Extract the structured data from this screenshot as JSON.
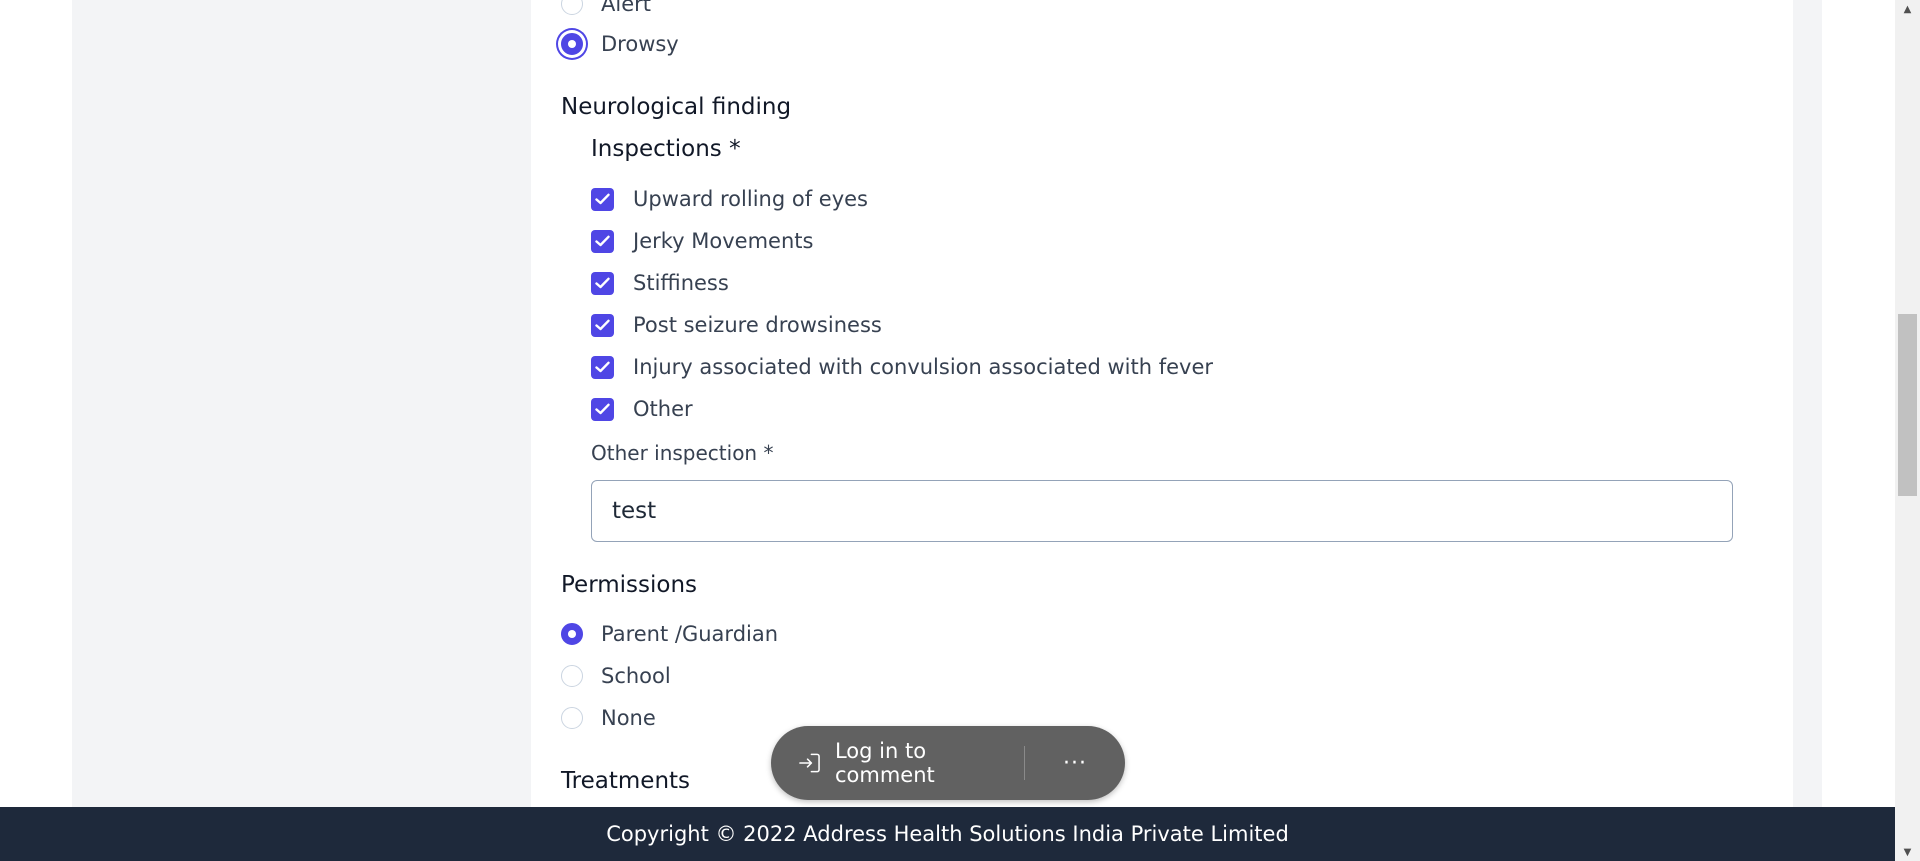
{
  "consciousness": {
    "options": [
      {
        "label": "Alert",
        "checked": false
      },
      {
        "label": "Drowsy",
        "checked": true
      }
    ]
  },
  "neurological": {
    "title": "Neurological finding",
    "inspections_label": "Inspections *",
    "inspections": [
      {
        "label": "Upward rolling of eyes",
        "checked": true
      },
      {
        "label": "Jerky Movements",
        "checked": true
      },
      {
        "label": "Stiffiness",
        "checked": true
      },
      {
        "label": "Post seizure drowsiness",
        "checked": true
      },
      {
        "label": "Injury associated with convulsion associated with fever",
        "checked": true
      },
      {
        "label": "Other",
        "checked": true
      }
    ],
    "other_inspection_label": "Other inspection *",
    "other_inspection_value": "test"
  },
  "permissions": {
    "title": "Permissions",
    "options": [
      {
        "label": "Parent /Guardian",
        "checked": true
      },
      {
        "label": "School",
        "checked": false
      },
      {
        "label": "None",
        "checked": false
      }
    ]
  },
  "treatments": {
    "title": "Treatments"
  },
  "comment_bar": {
    "label": "Log in to comment",
    "more": "···"
  },
  "footer": {
    "text": "Copyright © 2022 Address Health Solutions India Private Limited"
  },
  "colors": {
    "accent": "#4f46e5",
    "footer_bg": "#1e293b",
    "page_bg": "#f3f4f6"
  }
}
